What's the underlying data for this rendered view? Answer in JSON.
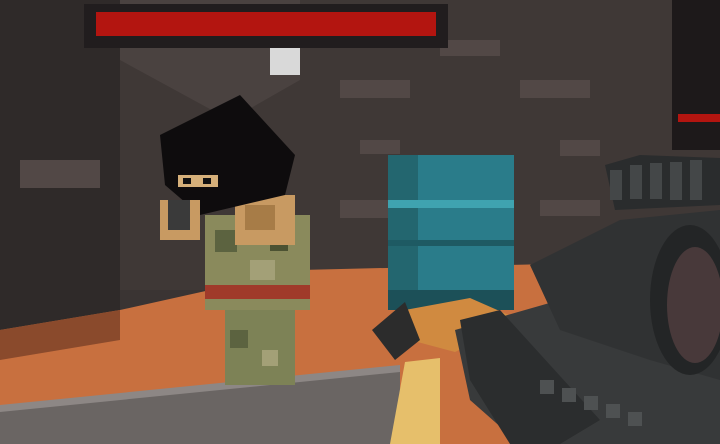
{
  "hud": {
    "target_health": 1.0,
    "side_meter": 1.0
  },
  "scene": {
    "colors": {
      "wall": "#3d3634",
      "floor": "#c8703f",
      "barrel": "#2a7c8a",
      "health_fill": "#b31510",
      "health_bg": "#211d1e"
    },
    "objects": [
      "enemy-soldier",
      "teal-barrel",
      "sniper-rifle",
      "player-hand"
    ]
  }
}
